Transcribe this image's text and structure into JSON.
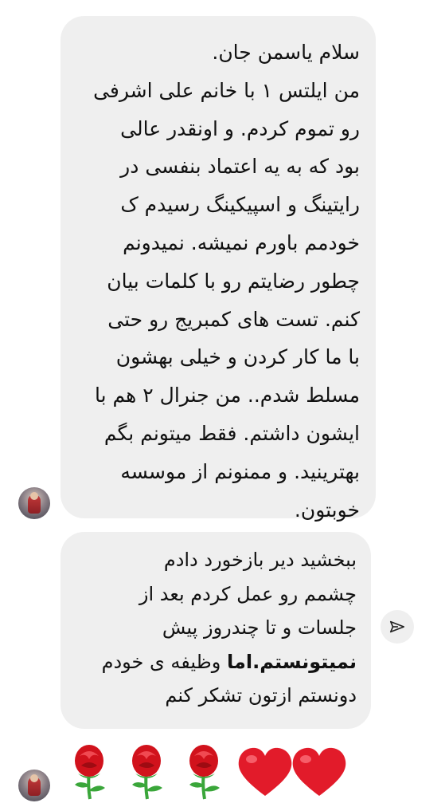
{
  "thread": {
    "message1": {
      "lines": [
        "سلام یاسمن جان.",
        "من ایلتس ۱ با خانم علی اشرفی",
        "رو تموم کردم. و اونقدر عالی",
        "بود که  به یه اعتماد بنفسی در",
        "رایتینگ و اسپیکینگ رسیدم ک",
        "خودمم باورم نمیشه. نمیدونم",
        "چطور رضایتم رو با کلمات بیان",
        "کنم. تست های کمبریج رو حتی",
        "با ما کار کردن و خیلی بهشون",
        "مسلط شدم.. من جنرال ۲ هم با",
        "ایشون داشتم. فقط میتونم بگم",
        "بهترینید. و ممنونم از موسسه",
        "خوبتون."
      ]
    },
    "message2": {
      "lines": [
        "ببخشید دیر بازخورد دادم",
        "چشمم رو عمل کردم بعد از",
        "جلسات و  تا چندروز پیش"
      ],
      "bold_part": "نمیتونستم.اما",
      "after_bold": " وظیفه ی خودم",
      "last_line": "دونستم ازتون تشکر کنم"
    },
    "reactions": {
      "emojis": [
        "rose",
        "rose",
        "rose",
        "red-heart",
        "red-heart"
      ]
    }
  },
  "colors": {
    "bubble": "#efefef",
    "text": "#111111",
    "heart": "#e21b2a",
    "rose": "#d1121c",
    "stem": "#3aa63a"
  },
  "icons": {
    "share": "send-arrow-icon",
    "avatar": "profile-avatar"
  }
}
